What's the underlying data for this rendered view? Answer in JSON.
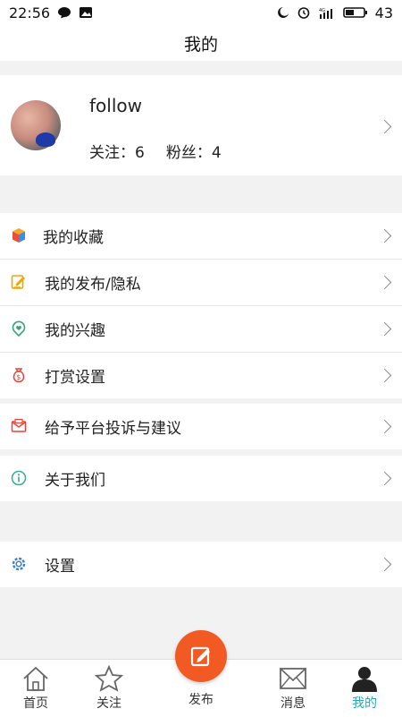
{
  "status": {
    "time": "22:56",
    "battery": "43",
    "network": "4G"
  },
  "header": {
    "title": "我的"
  },
  "profile": {
    "username": "follow",
    "following_label": "关注：6",
    "fans_label": "粉丝：4"
  },
  "menu": [
    {
      "label": "我的收藏"
    },
    {
      "label": "我的发布/隐私"
    },
    {
      "label": "我的兴趣"
    },
    {
      "label": "打赏设置"
    },
    {
      "label": "给予平台投诉与建议"
    },
    {
      "label": "关于我们"
    },
    {
      "label": "设置"
    }
  ],
  "nav": {
    "home": "首页",
    "follow": "关注",
    "publish": "发布",
    "messages": "消息",
    "mine": "我的"
  },
  "colors": {
    "accent": "#f15a22",
    "active_tab": "#2aa6b4"
  }
}
